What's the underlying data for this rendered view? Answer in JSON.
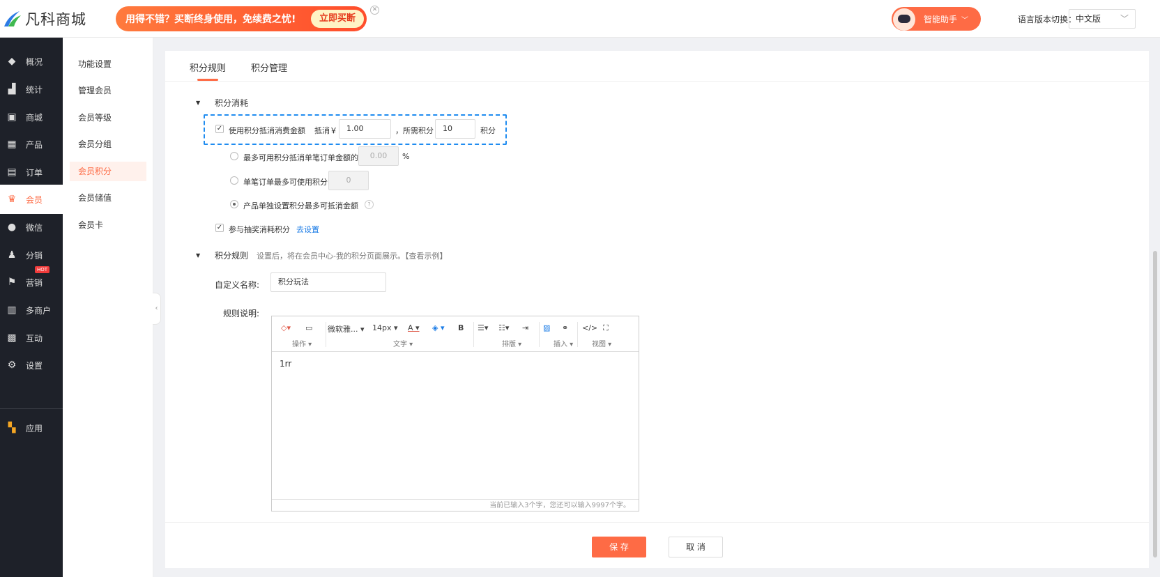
{
  "brand": {
    "name": "凡科商城"
  },
  "promo": {
    "text": "用得不错？买断终身使用，免续费之忧!",
    "button": "立即买断"
  },
  "assistant": {
    "label": "智能助手"
  },
  "language": {
    "label": "语言版本切换：",
    "value": "中文版"
  },
  "sidebar": {
    "items": [
      {
        "label": "概况",
        "icon": "layers-icon"
      },
      {
        "label": "统计",
        "icon": "chart-icon"
      },
      {
        "label": "商城",
        "icon": "store-icon"
      },
      {
        "label": "产品",
        "icon": "grid-icon"
      },
      {
        "label": "订单",
        "icon": "clipboard-icon"
      },
      {
        "label": "会员",
        "icon": "crown-icon"
      },
      {
        "label": "微信",
        "icon": "wechat-icon"
      },
      {
        "label": "分销",
        "icon": "users-icon"
      },
      {
        "label": "营销",
        "icon": "flag-icon",
        "badge": "HOT"
      },
      {
        "label": "多商户",
        "icon": "shop-icon"
      },
      {
        "label": "互动",
        "icon": "apps-icon"
      },
      {
        "label": "设置",
        "icon": "gear-icon"
      },
      {
        "label": "应用",
        "icon": "app-grid-icon"
      }
    ]
  },
  "subnav": {
    "items": [
      "功能设置",
      "管理会员",
      "会员等级",
      "会员分组",
      "会员积分",
      "会员储值",
      "会员卡"
    ]
  },
  "tabs": [
    "积分规则",
    "积分管理"
  ],
  "consume": {
    "title": "积分消耗",
    "use_label": "使用积分抵消消费金额",
    "offset_label": "抵消￥",
    "offset_value": "1.00",
    "need_label": "，所需积分",
    "need_value": "10",
    "unit": "积分",
    "opt1": "最多可用积分抵消单笔订单金额的",
    "opt1_value": "0.00",
    "opt1_unit": "%",
    "opt2": "单笔订单最多可使用积分",
    "opt2_value": "0",
    "opt3": "产品单独设置积分最多可抵消金额",
    "lottery": "参与抽奖消耗积分",
    "lottery_link": "去设置"
  },
  "rules": {
    "title": "积分规则",
    "hint": "设置后，将在会员中心-我的积分页面展示。【查看示例】",
    "name_label": "自定义名称:",
    "name_value": "积分玩法",
    "desc_label": "规则说明:"
  },
  "editor": {
    "font": "微软雅...",
    "size": "14px",
    "groups": [
      "操作",
      "文字",
      "排版",
      "插入",
      "视图"
    ],
    "content": "1rr",
    "status": "当前已输入3个字，您还可以输入9997个字。"
  },
  "footer": {
    "save": "保 存",
    "cancel": "取 消"
  },
  "colors": {
    "accent": "#fe6b45",
    "link": "#1a7be6",
    "sidebar": "#1e2129"
  }
}
